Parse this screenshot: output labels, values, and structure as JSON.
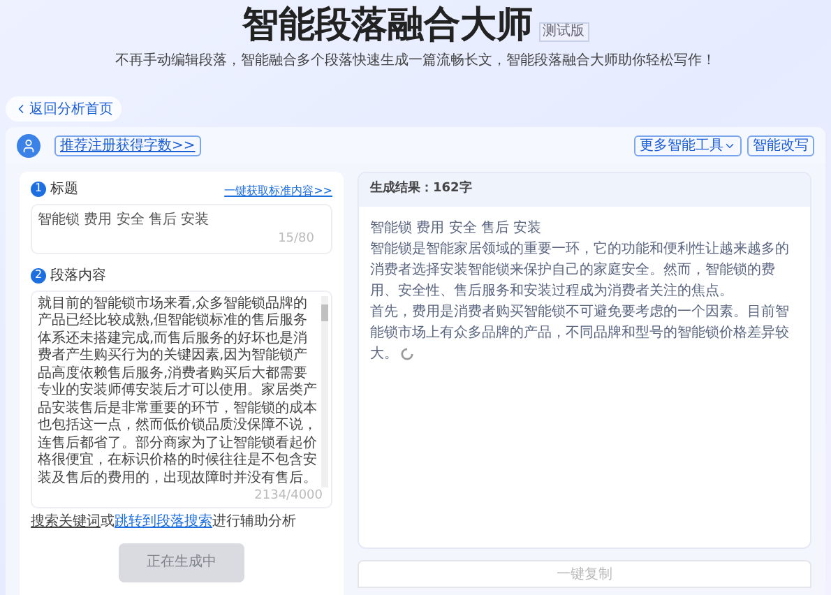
{
  "header": {
    "title": "智能段落融合大师",
    "badge": "测试版",
    "subtitle": "不再手动编辑段落，智能融合多个段落快速生成一篇流畅长文，智能段落融合大师助你轻松写作！"
  },
  "back_button": "返回分析首页",
  "toolbar": {
    "promo_link": "推荐注册获得字数>>",
    "more_tools": "更多智能工具",
    "rewrite_button": "智能改写"
  },
  "title_section": {
    "number": "1",
    "label": "标题",
    "link": "一键获取标准内容>>",
    "value": "智能锁 费用 安全 售后 安装",
    "counter": "15/80"
  },
  "content_section": {
    "number": "2",
    "label": "段落内容",
    "value": "就目前的智能锁市场来看,众多智能锁品牌的产品已经比较成熟,但智能锁标准的售后服务体系还未搭建完成,而售后服务的好坏也是消费者产生购买行为的关键因素,因为智能锁产品高度依赖售后服务,消费者购买后大都需要专业的安装师傅安装后才可以使用。家居类产品安装售后是非常重要的环节，智能锁的成本也包括这一点，然而低价锁品质没保障不说，连售后都省了。部分商家为了让智能锁看起价格很便宜，在标识价格的时候往往是不包含安装及售后的费用的，出现故障时并没有售后。",
    "counter": "2134/4000"
  },
  "helper": {
    "link_1": "搜索关键词",
    "text_1": "或",
    "link_2": "跳转到段落搜索",
    "text_2": "进行辅助分析"
  },
  "generate_button": {
    "label": "正在生成中",
    "disabled": true
  },
  "result": {
    "heading": "生成结果：162字",
    "paragraphs": [
      "智能锁 费用 安全 售后 安装",
      "智能锁是智能家居领域的重要一环，它的功能和便利性让越来越多的消费者选择安装智能锁来保护自己的家庭安全。然而，智能锁的费用、安全性、售后服务和安装过程成为消费者关注的焦点。",
      "首先，费用是消费者购买智能锁不可避免要考虑的一个因素。目前智能锁市场上有众多品牌的产品，不同品牌和型号的智能锁价格差异较大。"
    ],
    "loading": true
  },
  "copy_button": "一键复制"
}
